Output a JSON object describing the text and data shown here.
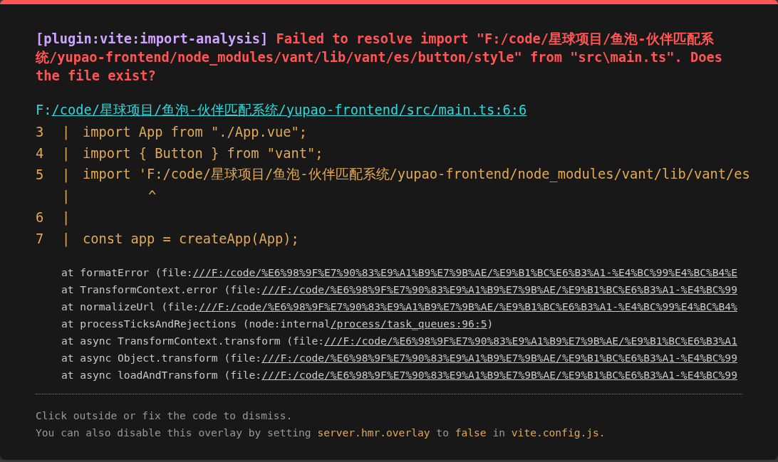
{
  "message": {
    "plugin": "[plugin:vite:import-analysis]",
    "text": "Failed to resolve import \"F:/code/星球项目/鱼泡-伙伴匹配系统/yupao-frontend/node_modules/vant/lib/vant/es/button/style\" from \"src\\main.ts\". Does the file exist?"
  },
  "file": [
    {
      "text": "F:",
      "link": false
    },
    {
      "text": "/code/星球项目/鱼泡-伙伴匹配系统/yupao-frontend/src/main.ts:6:6",
      "link": true
    }
  ],
  "frame": [
    {
      "kind": "line",
      "num": "3",
      "bar": "|",
      "code": "import App from \"./App.vue\";"
    },
    {
      "kind": "line",
      "num": "4",
      "bar": "|",
      "code": "import { Button } from \"vant\";"
    },
    {
      "kind": "line",
      "num": "5",
      "bar": "|",
      "code": "import 'F:/code/星球项目/鱼泡-伙伴匹配系统/yupao-frontend/node_modules/vant/lib/vant/es"
    },
    {
      "kind": "caret",
      "bar": "|",
      "code": "^"
    },
    {
      "kind": "line",
      "num": "6",
      "bar": "|"
    },
    {
      "kind": "line",
      "num": "7",
      "bar": "|",
      "code": "const app = createApp(App);"
    }
  ],
  "stack": [
    {
      "call": "at formatError (file:",
      "link": "///F:/code/%E6%98%9F%E7%90%83%E9%A1%B9%E7%9B%AE/%E9%B1%BC%E6%B3%A1-%E4%BC%99%E4%BC%B4%E"
    },
    {
      "call": "at TransformContext.error (file:",
      "link": "///F:/code/%E6%98%9F%E7%90%83%E9%A1%B9%E7%9B%AE/%E9%B1%BC%E6%B3%A1-%E4%BC%99"
    },
    {
      "call": "at normalizeUrl (file:",
      "link": "///F:/code/%E6%98%9F%E7%90%83%E9%A1%B9%E7%9B%AE/%E9%B1%BC%E6%B3%A1-%E4%BC%99%E4%BC%B4%"
    },
    {
      "call": "at processTicksAndRejections (node:internal",
      "link": "/process/task_queues:96:5",
      "tail": ")"
    },
    {
      "call": "at async TransformContext.transform (file:",
      "link": "///F:/code/%E6%98%9F%E7%90%83%E9%A1%B9%E7%9B%AE/%E9%B1%BC%E6%B3%A1"
    },
    {
      "call": "at async Object.transform (file:",
      "link": "///F:/code/%E6%98%9F%E7%90%83%E9%A1%B9%E7%9B%AE/%E9%B1%BC%E6%B3%A1-%E4%BC%99"
    },
    {
      "call": "at async loadAndTransform (file:",
      "link": "///F:/code/%E6%98%9F%E7%90%83%E9%A1%B9%E7%9B%AE/%E9%B1%BC%E6%B3%A1-%E4%BC%99"
    }
  ],
  "tip": {
    "line1": "Click outside or fix the code to dismiss.",
    "line2": [
      {
        "kind": "plain",
        "text": "You can also disable this overlay by setting"
      },
      {
        "kind": "code",
        "text": "server.hmr.overlay"
      },
      {
        "kind": "plain",
        "text": "to"
      },
      {
        "kind": "code",
        "text": "false"
      },
      {
        "kind": "plain",
        "text": "in"
      },
      {
        "kind": "code",
        "text": "vite.config.js."
      }
    ]
  }
}
